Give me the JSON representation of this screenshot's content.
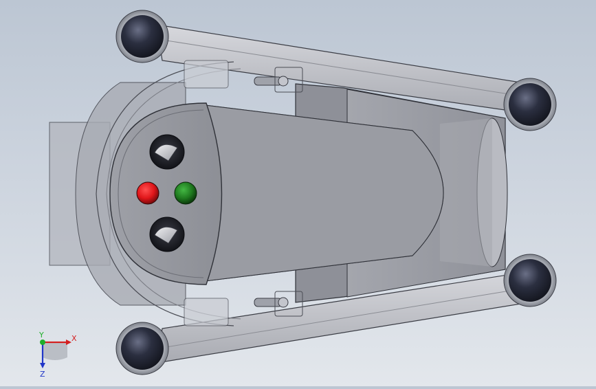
{
  "viewport": {
    "background_top": "#bcc6d3",
    "background_bottom": "#e3e7ec"
  },
  "model": {
    "parts": [
      "caster-wheel-top-left",
      "caster-wheel-top-right",
      "caster-wheel-bottom-right",
      "caster-wheel-bottom-left",
      "frame-rail-top",
      "frame-rail-bottom",
      "hopper-housing",
      "chute-trough",
      "control-panel",
      "knob-top",
      "knob-bottom",
      "button-red",
      "button-green",
      "hinge-top",
      "hinge-bottom"
    ],
    "colors": {
      "red_button": "#e0161a",
      "green_button": "#1f7a1f",
      "wheel": "#1c1f2b",
      "body": "#9a9ca3"
    }
  },
  "triad": {
    "x_label": "X",
    "y_label": "Y",
    "z_label": "Z",
    "x_color": "#d42020",
    "y_color": "#1faf2a",
    "z_color": "#2036c8"
  }
}
